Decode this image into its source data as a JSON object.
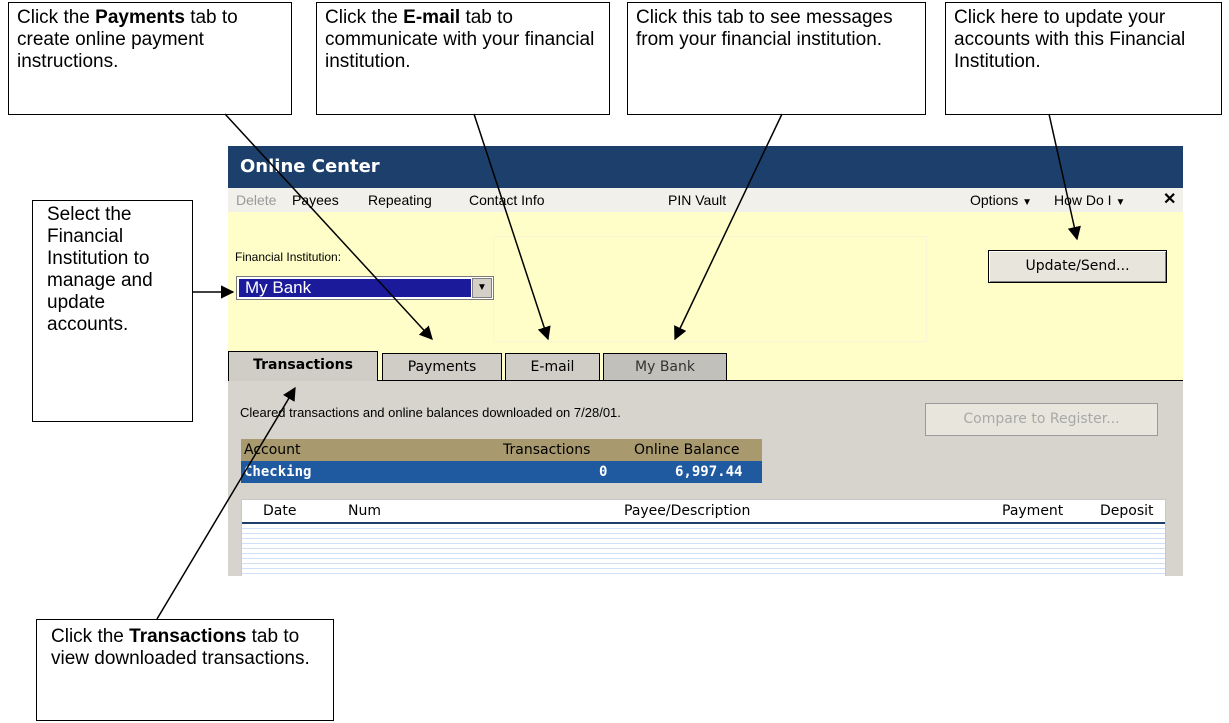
{
  "callouts": {
    "payments": {
      "pre": "Click the ",
      "bold": "Payments",
      "post": " tab to create online payment instructions."
    },
    "email": {
      "pre": "Click the ",
      "bold": "E-mail",
      "post": " tab to communicate with your financial institution."
    },
    "bank_tab": {
      "text": "Click this tab to see messages from your financial institution."
    },
    "update": {
      "text": "Click here to update your accounts with this Financial Institution."
    },
    "select_fi": {
      "text": "Select the Financial Institution to manage and update accounts."
    },
    "transactions": {
      "pre": "Click the ",
      "bold": "Transactions",
      "post": " tab to view downloaded transactions."
    }
  },
  "window": {
    "title": "Online Center",
    "menu": {
      "delete": "Delete",
      "payees": "Payees",
      "repeating": "Repeating",
      "contact_info": "Contact Info",
      "pin_vault": "PIN Vault",
      "options": "Options",
      "how_do_i": "How Do I",
      "close": "✕"
    },
    "fi_label": "Financial Institution:",
    "fi_selected": "My Bank",
    "update_button": "Update/Send...",
    "tabs": [
      "Transactions",
      "Payments",
      "E-mail",
      "My Bank"
    ],
    "cleared_text": "Cleared transactions and online balances downloaded on 7/28/01.",
    "compare_button": "Compare to Register...",
    "account_table": {
      "headers": [
        "Account",
        "Transactions",
        "Online Balance"
      ],
      "rows": [
        {
          "account": "Checking",
          "transactions": "0",
          "balance": "6,997.44"
        }
      ]
    },
    "register_headers": [
      "Date",
      "Num",
      "Payee/Description",
      "Payment",
      "Deposit"
    ]
  },
  "colors": {
    "title_bar": "#1c3f6b",
    "window_bg": "#fffec8",
    "account_header": "#a89a6e",
    "account_row": "#1f5aa0",
    "selection": "#1a1a9a"
  },
  "icons": [
    "dropdown-arrow-icon",
    "chevron-down-icon",
    "close-icon"
  ]
}
